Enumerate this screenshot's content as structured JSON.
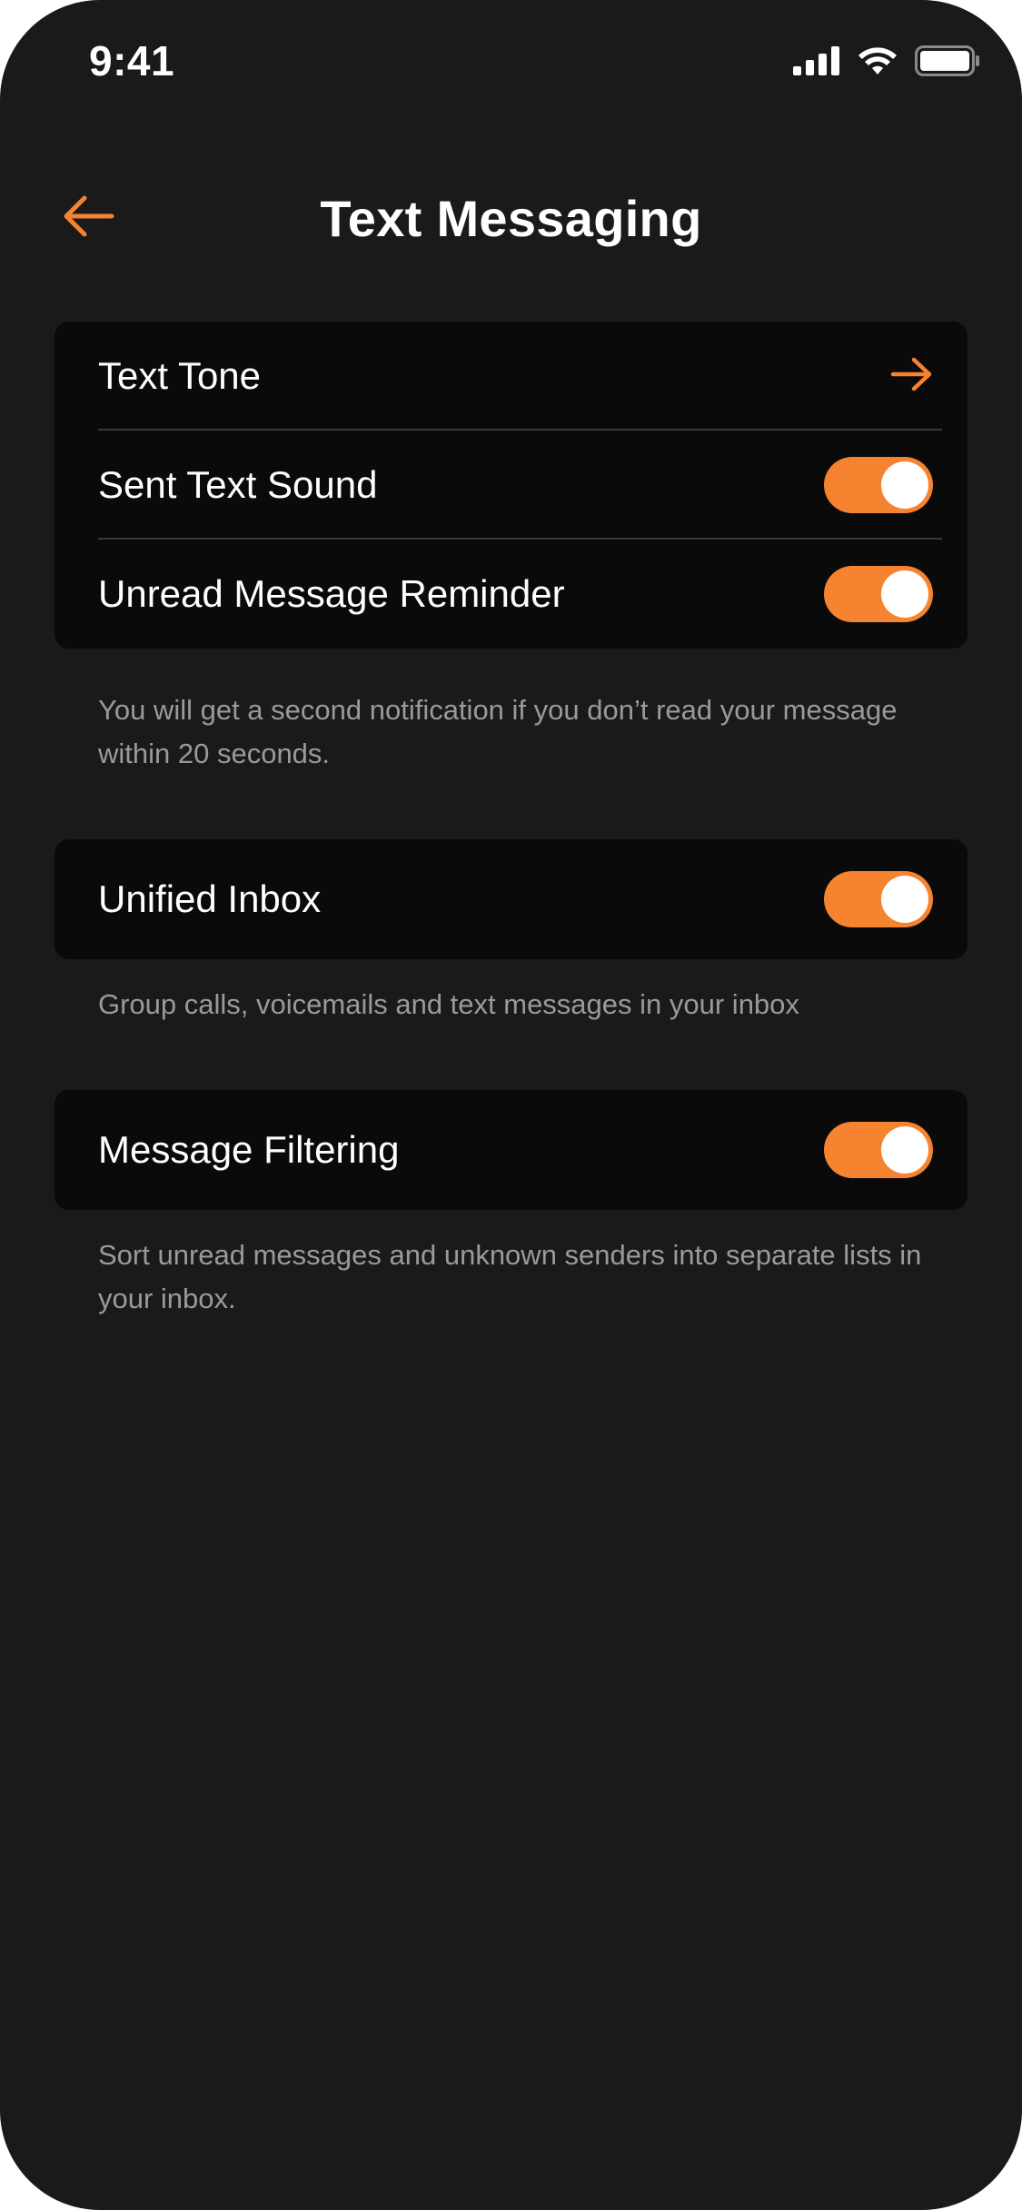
{
  "status_bar": {
    "time": "9:41",
    "icons": [
      "signal-icon",
      "wifi-icon",
      "battery-icon"
    ]
  },
  "header": {
    "back_icon": "arrow-left-icon",
    "title": "Text Messaging"
  },
  "colors": {
    "background": "#1a1a1a",
    "card": "#0a0a0a",
    "accent": "#f5832f",
    "text": "#ffffff",
    "muted": "#9a9a9a"
  },
  "section1": {
    "text_tone": {
      "label": "Text Tone",
      "icon": "arrow-right-icon"
    },
    "sent_text_sound": {
      "label": "Sent Text Sound",
      "enabled": true
    },
    "unread_reminder": {
      "label": "Unread Message Reminder",
      "enabled": true
    },
    "footnote": "You will get a second notification if you don’t read your message within 20 seconds."
  },
  "section2": {
    "unified_inbox": {
      "label": "Unified Inbox",
      "enabled": true
    },
    "footnote": "Group calls, voicemails and text messages in your inbox"
  },
  "section3": {
    "message_filtering": {
      "label": "Message Filtering",
      "enabled": true
    },
    "footnote": "Sort unread messages and unknown senders into separate lists in your inbox."
  }
}
